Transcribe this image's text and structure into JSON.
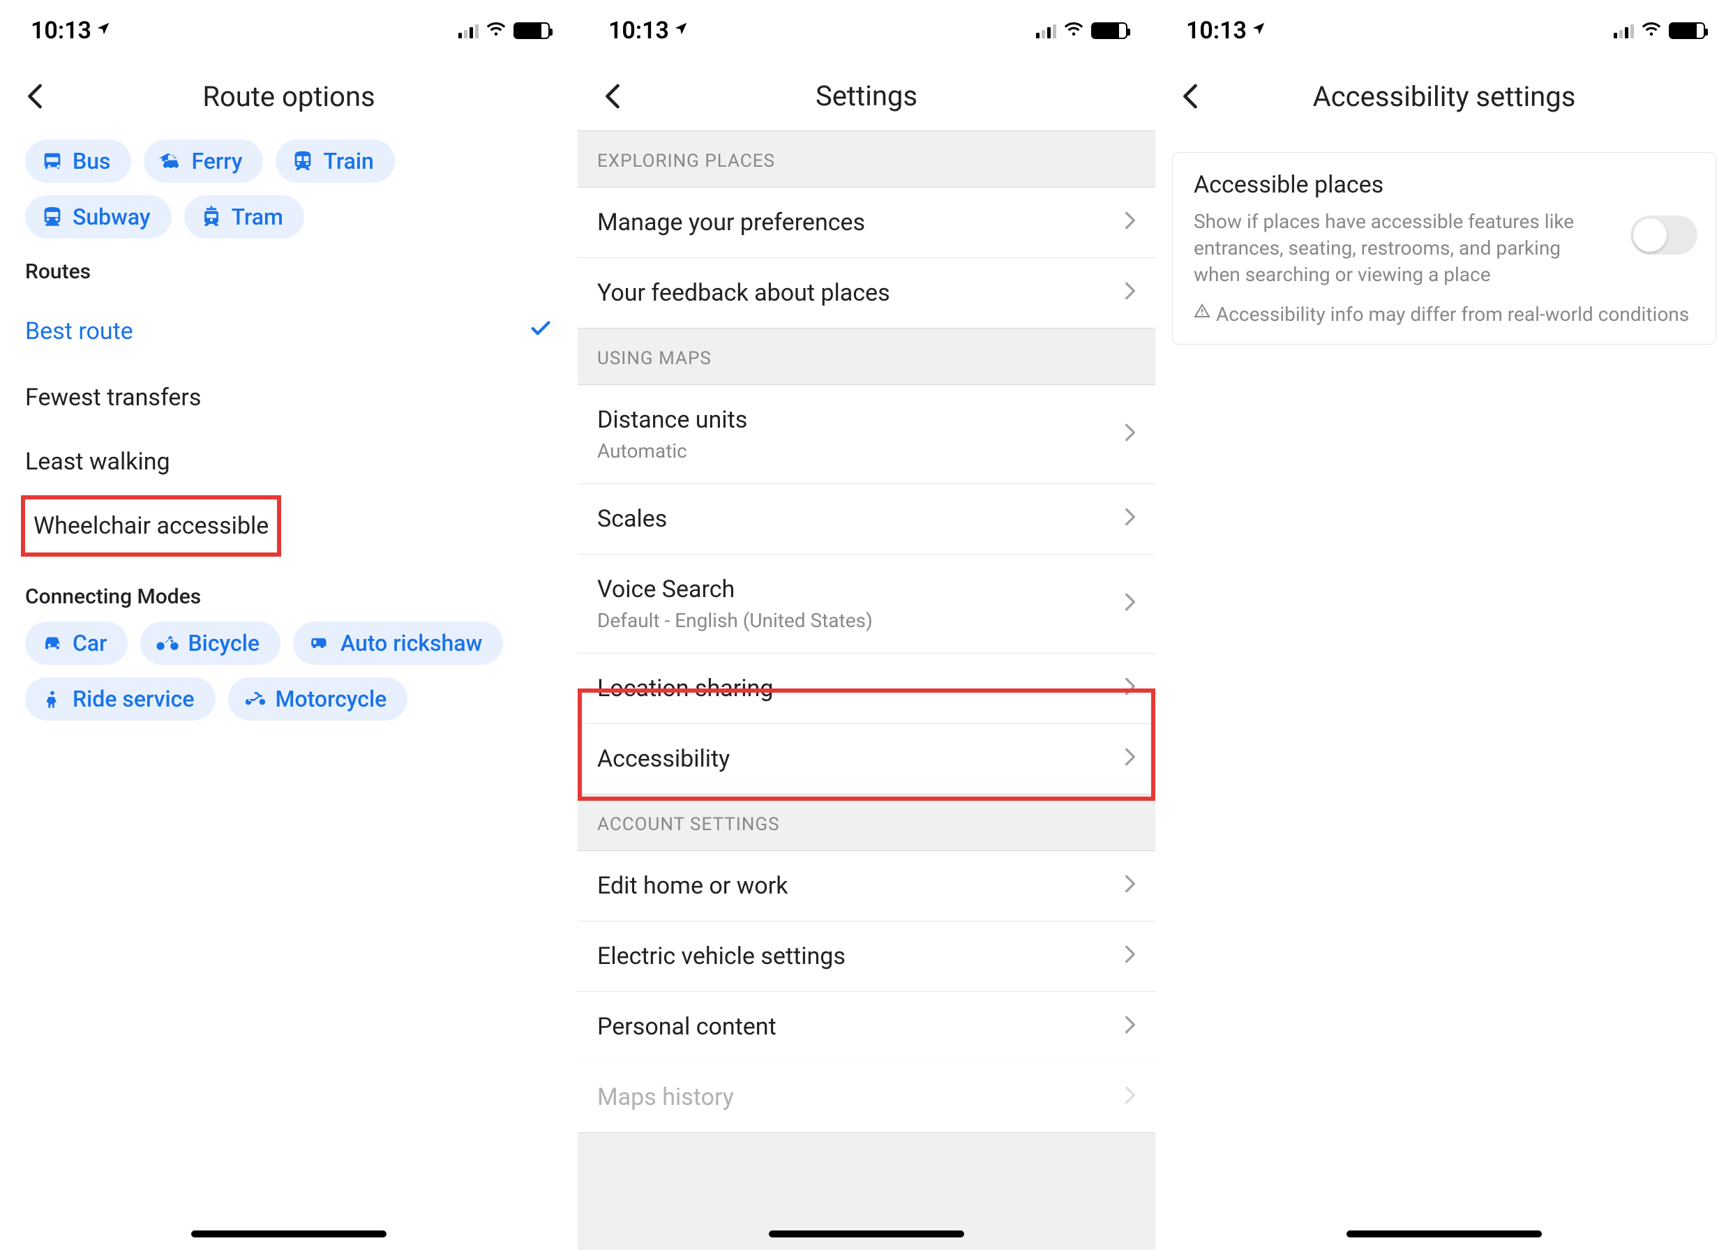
{
  "statusbar": {
    "time": "10:13"
  },
  "screen1": {
    "title": "Route options",
    "transit_chips": [
      {
        "key": "bus",
        "label": "Bus"
      },
      {
        "key": "ferry",
        "label": "Ferry"
      },
      {
        "key": "train",
        "label": "Train"
      },
      {
        "key": "subway",
        "label": "Subway"
      },
      {
        "key": "tram",
        "label": "Tram"
      }
    ],
    "routes_label": "Routes",
    "routes": [
      {
        "label": "Best route",
        "selected": true
      },
      {
        "label": "Fewest transfers",
        "selected": false
      },
      {
        "label": "Least walking",
        "selected": false
      },
      {
        "label": "Wheelchair accessible",
        "selected": false,
        "highlight": true
      }
    ],
    "connecting_label": "Connecting Modes",
    "connecting_chips": [
      {
        "key": "car",
        "label": "Car"
      },
      {
        "key": "bicycle",
        "label": "Bicycle"
      },
      {
        "key": "autorickshaw",
        "label": "Auto rickshaw"
      },
      {
        "key": "rideservice",
        "label": "Ride service"
      },
      {
        "key": "motorcycle",
        "label": "Motorcycle"
      }
    ]
  },
  "screen2": {
    "title": "Settings",
    "groups": [
      {
        "header": "EXPLORING PLACES",
        "rows": [
          {
            "label": "Manage your preferences"
          },
          {
            "label": "Your feedback about places"
          }
        ]
      },
      {
        "header": "USING MAPS",
        "rows": [
          {
            "label": "Distance units",
            "sub": "Automatic"
          },
          {
            "label": "Scales"
          },
          {
            "label": "Voice Search",
            "sub": "Default - English (United States)"
          },
          {
            "label": "Location sharing"
          },
          {
            "label": "Accessibility",
            "highlight": true
          }
        ]
      },
      {
        "header": "ACCOUNT SETTINGS",
        "rows": [
          {
            "label": "Edit home or work"
          },
          {
            "label": "Electric vehicle settings"
          },
          {
            "label": "Personal content"
          },
          {
            "label": "Maps history"
          }
        ]
      }
    ]
  },
  "screen3": {
    "title": "Accessibility settings",
    "card": {
      "title": "Accessible places",
      "desc": "Show if places have accessible features like entrances, seating, restrooms, and parking when searching or viewing a place",
      "note": "Accessibility info may differ from real-world conditions",
      "toggle_on": false
    }
  }
}
